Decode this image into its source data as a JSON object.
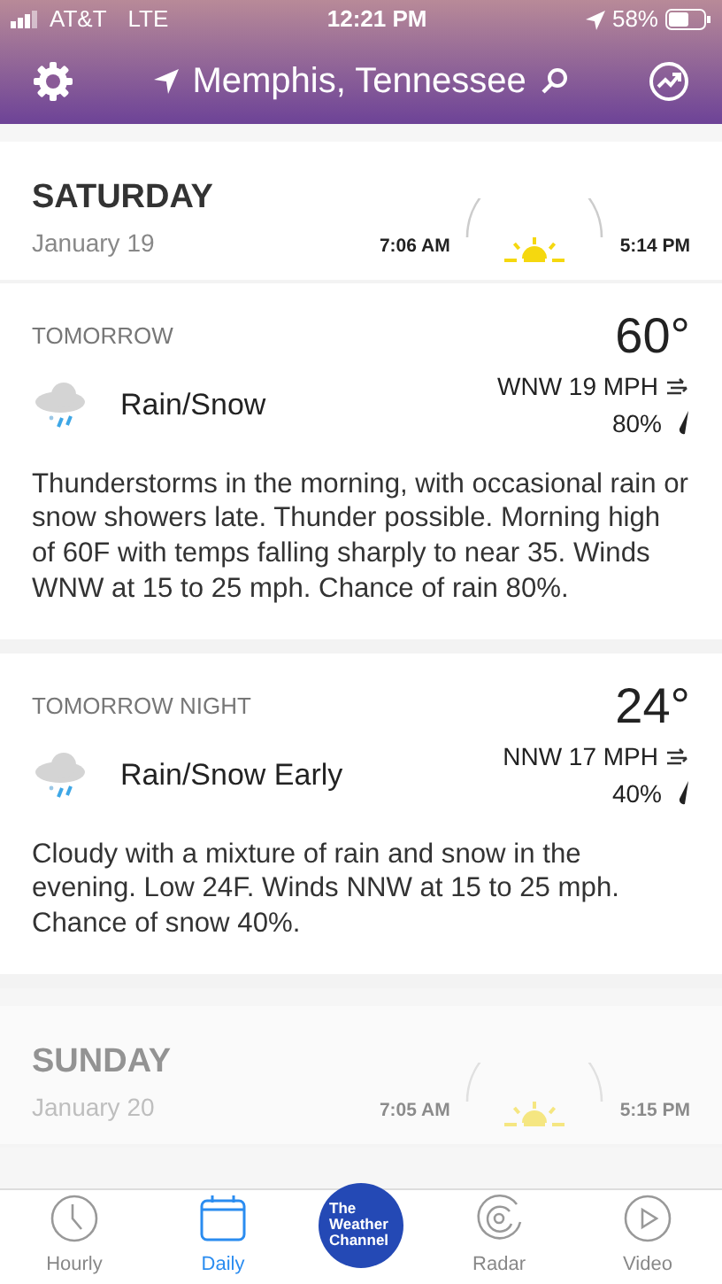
{
  "status_bar": {
    "carrier": "AT&T",
    "network": "LTE",
    "time": "12:21 PM",
    "battery": "58%"
  },
  "header": {
    "location": "Memphis, Tennessee"
  },
  "days": [
    {
      "day": "SATURDAY",
      "date": "January 19",
      "sunrise": "7:06 AM",
      "sunset": "5:14 PM",
      "dimmed": false,
      "periods": [
        {
          "label": "TOMORROW",
          "temp": "60°",
          "condition": "Rain/Snow",
          "wind": "WNW 19 MPH",
          "precip": "80%",
          "description": "Thunderstorms in the morning, with occasional rain or snow showers late. Thunder possible. Morning high of 60F with temps falling sharply to near 35. Winds WNW at 15 to 25 mph. Chance of rain 80%."
        },
        {
          "label": "TOMORROW NIGHT",
          "temp": "24°",
          "condition": "Rain/Snow Early",
          "wind": "NNW 17 MPH",
          "precip": "40%",
          "description": "Cloudy with a mixture of rain and snow in the evening. Low 24F. Winds NNW at 15 to 25 mph. Chance of snow 40%."
        }
      ]
    },
    {
      "day": "SUNDAY",
      "date": "January 20",
      "sunrise": "7:05 AM",
      "sunset": "5:15 PM",
      "dimmed": true
    }
  ],
  "tab_bar": [
    {
      "kind": "clock",
      "label": "Hourly",
      "selected": false
    },
    {
      "kind": "calendar",
      "label": "Daily",
      "selected": true
    },
    {
      "kind": "logo",
      "label": "The Weather Channel"
    },
    {
      "kind": "radar",
      "label": "Radar",
      "selected": false
    },
    {
      "kind": "play",
      "label": "Video",
      "selected": false
    }
  ]
}
